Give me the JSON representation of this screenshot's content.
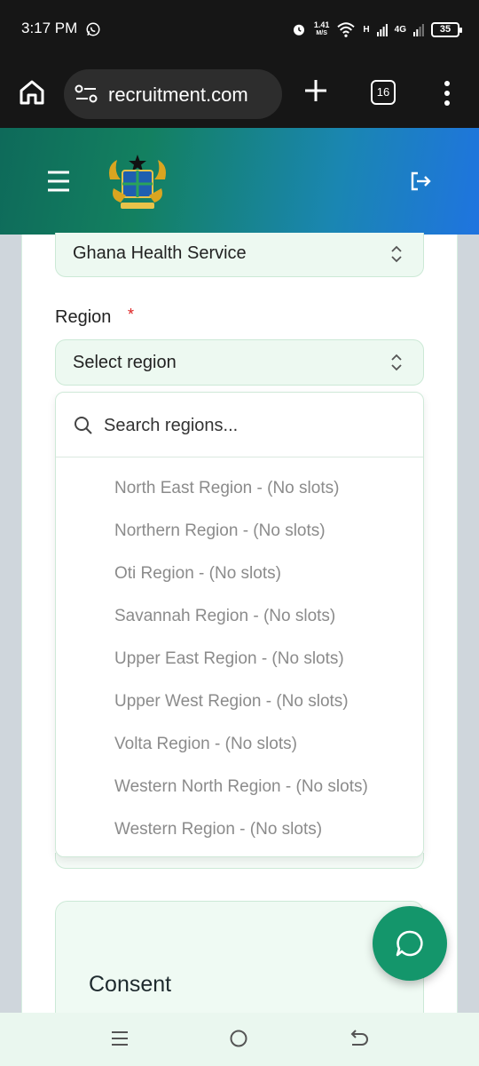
{
  "status_bar": {
    "time": "3:17 PM",
    "speed_top": "1.41",
    "speed_unit": "M/S",
    "network_label": "4G",
    "signal_label": "H",
    "battery": "35"
  },
  "browser": {
    "url": "recruitment.com",
    "tab_count": "16"
  },
  "form": {
    "organization_value": "Ghana Health Service",
    "region_label": "Region",
    "required_marker": "*",
    "region_placeholder": "Select region"
  },
  "dropdown": {
    "search_placeholder": "Search regions...",
    "options": [
      "North East Region - (No slots)",
      "Northern Region - (No slots)",
      "Oti Region - (No slots)",
      "Savannah Region - (No slots)",
      "Upper East Region - (No slots)",
      "Upper West Region - (No slots)",
      "Volta Region - (No slots)",
      "Western North Region - (No slots)",
      "Western Region - (No slots)"
    ]
  },
  "consent": {
    "title": "Consent"
  },
  "colors": {
    "header_start": "#0e6a5a",
    "header_end": "#1f74e0",
    "fab": "#14966b",
    "field_bg": "#edf9f1",
    "option_text": "#8b8b8b",
    "required": "#dd2222"
  },
  "icons": {
    "whatsapp": "whatsapp-icon",
    "home": "home-icon",
    "site_settings": "site-settings-icon",
    "new_tab": "plus-icon",
    "overflow": "more-vertical-icon",
    "menu": "hamburger-icon",
    "logo": "ghana-coat-of-arms-logo",
    "logout": "logout-icon",
    "chevrons": "chevron-up-down-icon",
    "search": "search-icon",
    "chat": "chat-bubble-icon"
  }
}
